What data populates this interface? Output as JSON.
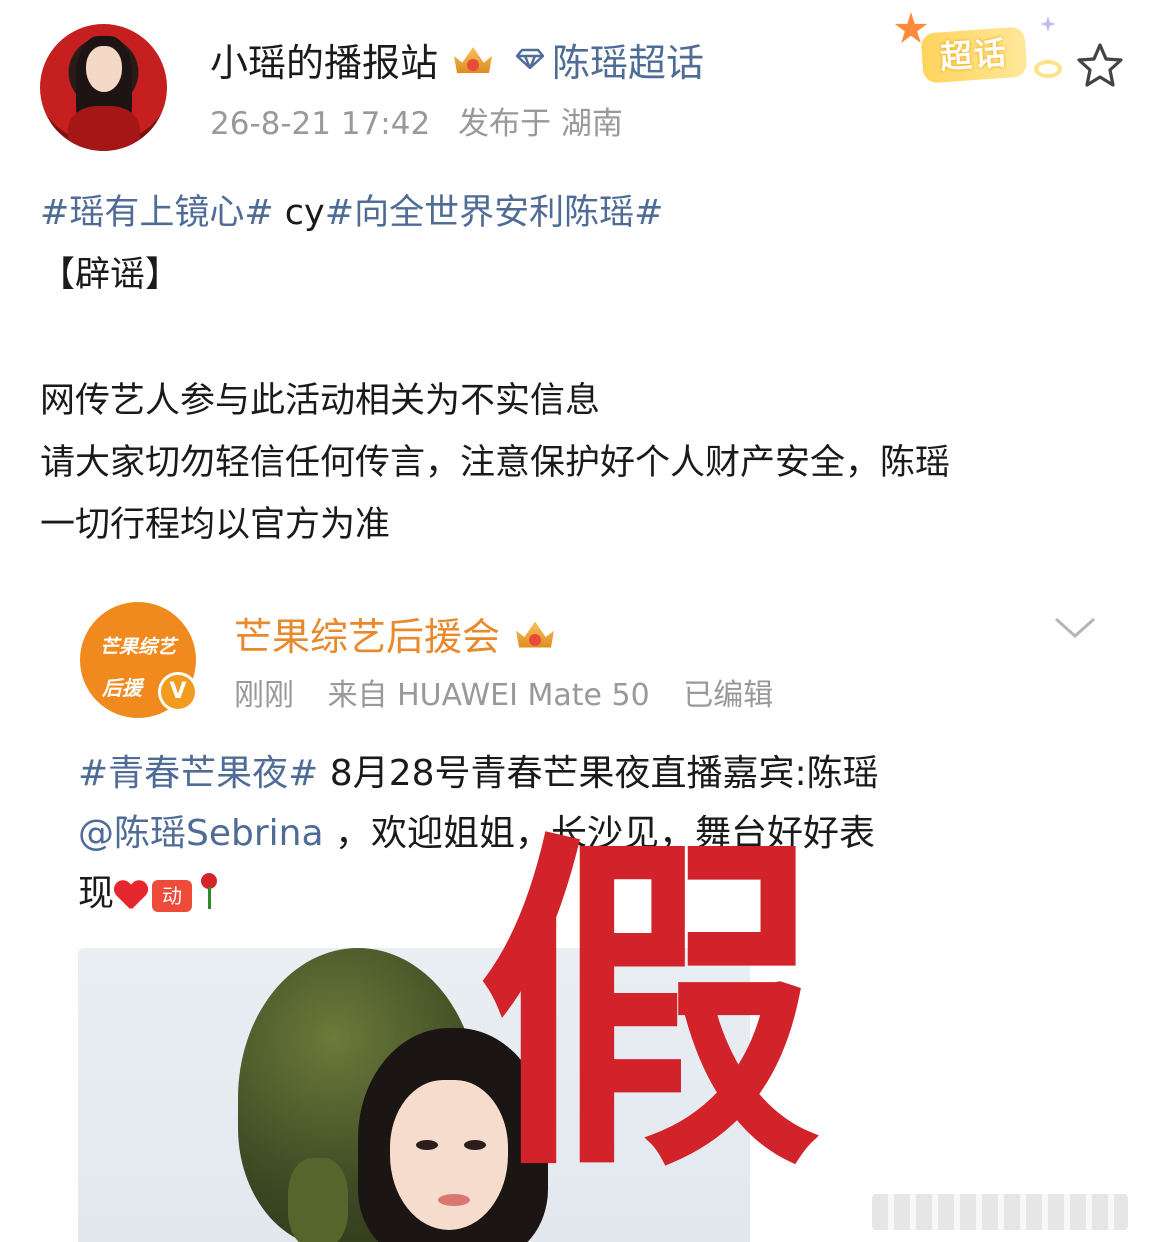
{
  "header": {
    "username": "小瑶的播报站",
    "topic": "陈瑶超话",
    "timestamp": "26-8-21 17:42",
    "location": "发布于 湖南",
    "chaohua_badge": "超话",
    "icons": [
      "crown-icon",
      "diamond-icon",
      "star-icon"
    ]
  },
  "post": {
    "hashtag1": "#瑶有上镜心#",
    "plain1": " cy",
    "hashtag2": "#向全世界安利陈瑶#",
    "line2": "【辟谣】",
    "line3": "网传艺人参与此活动相关为不实信息",
    "line4": "请大家切勿轻信任何传言，注意保护好个人财产安全，陈瑶",
    "line5": "一切行程均以官方为准"
  },
  "repost": {
    "avatar_line1": "芒果综艺",
    "avatar_line2": "后援",
    "verified": "V",
    "name": "芒果综艺后援会",
    "time": "刚刚",
    "source": "来自 HUAWEI Mate 50",
    "edited": "已编辑",
    "hashtag": "#青春芒果夜#",
    "text1": " 8月28号青春芒果夜直播嘉宾:陈瑶",
    "mention": "@陈瑶Sebrina",
    "text2": " ，欢迎姐姐，长沙见，舞台好好表",
    "text3": "现",
    "jiayou": "动",
    "stamp": "假"
  },
  "colors": {
    "link": "#4f6c96",
    "meta": "#999999",
    "repost_name": "#e8892c",
    "stamp": "#d2232a"
  }
}
